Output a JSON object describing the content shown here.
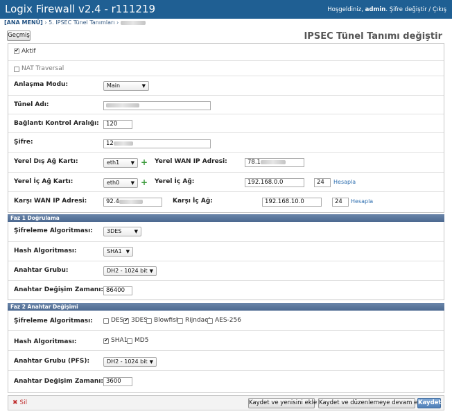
{
  "app": {
    "title": "Logix Firewall v2.4 - r111219",
    "greeting": "Hoşgeldiniz,",
    "user": "admin",
    "links": ". Şifre değiştir / Çıkış"
  },
  "breadcrumb": {
    "home": "[ANA MENÜ]",
    "item": " › 5. IPSEC Tünel Tanımları ›"
  },
  "toolbar": {
    "history": "Geçmiş"
  },
  "page_title": "IPSEC Tünel Tanımı değiştir",
  "general": {
    "active": "Aktif",
    "nat": "NAT Traversal",
    "mode_label": "Anlaşma Modu:",
    "mode_value": "Main",
    "tunnel_label": "Tünel Adı:",
    "interval_label": "Bağlantı Kontrol Aralığı:",
    "interval_value": "120",
    "password_label": "Şifre:",
    "password_value": "12",
    "local_wan_if_label": "Yerel Dış Ağ Kartı:",
    "local_wan_if_value": "eth1",
    "local_wan_ip_label": "Yerel WAN IP Adresi:",
    "local_wan_ip_value": "78.1",
    "local_lan_if_label": "Yerel İç Ağ Kartı:",
    "local_lan_if_value": "eth0",
    "local_lan_label": "Yerel İç Ağ:",
    "local_lan_value": "192.168.0.0",
    "local_lan_mask": "24",
    "calc1": "Hesapla",
    "remote_wan_label": "Karşı WAN IP Adresi:",
    "remote_wan_value": "92.4",
    "remote_lan_label": "Karşı İç Ağ:",
    "remote_lan_value": "192.168.10.0",
    "remote_lan_mask": "24",
    "calc2": "Hesapla"
  },
  "phase1": {
    "title": "Faz 1 Doğrulama",
    "enc_label": "Şifreleme Algoritması:",
    "enc_value": "3DES",
    "hash_label": "Hash Algoritması:",
    "hash_value": "SHA1",
    "group_label": "Anahtar Grubu:",
    "group_value": "DH2 - 1024 bit",
    "lifetime_label": "Anahtar Değişim Zamanı:",
    "lifetime_value": "86400"
  },
  "phase2": {
    "title": "Faz 2 Anahtar Değişimi",
    "enc_label": "Şifreleme Algoritması:",
    "enc_options": [
      {
        "label": "DES",
        "checked": false
      },
      {
        "label": "3DES",
        "checked": true
      },
      {
        "label": "Blowfish",
        "checked": false
      },
      {
        "label": "Rijndael",
        "checked": false
      },
      {
        "label": "AES-256",
        "checked": false
      }
    ],
    "hash_label": "Hash Algoritması:",
    "hash_options": [
      {
        "label": "SHA1",
        "checked": true
      },
      {
        "label": "MD5",
        "checked": false
      }
    ],
    "group_label": "Anahtar Grubu (PFS):",
    "group_value": "DH2 - 1024 bit",
    "lifetime_label": "Anahtar Değişim Zamanı:",
    "lifetime_value": "3600"
  },
  "footer": {
    "delete": "Sil",
    "save_add": "Kaydet ve yenisini ekle",
    "save_continue": "Kaydet ve düzenlemeye devam et",
    "save": "Kaydet"
  },
  "colors": {
    "topbar": "#1f5f93",
    "section": "#4c6990",
    "link": "#2f6fb0",
    "delete": "#c03030"
  }
}
